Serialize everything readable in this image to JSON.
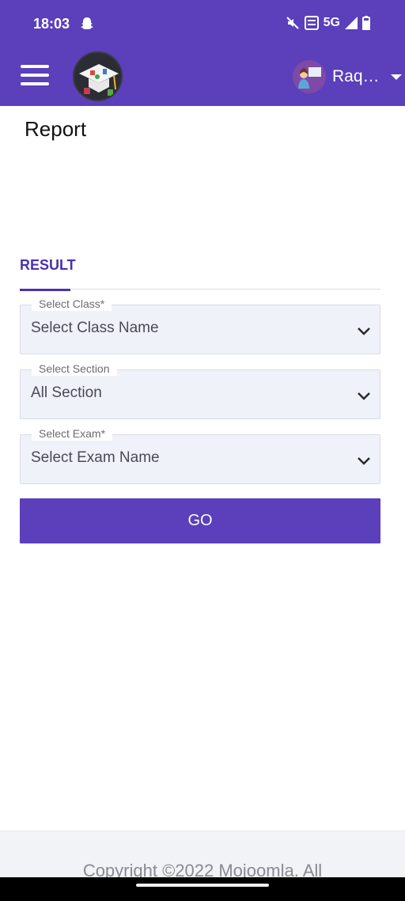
{
  "status_bar": {
    "time": "18:03",
    "network": "5G",
    "icons": [
      "snapchat-icon",
      "mute-icon",
      "volte-icon",
      "signal-icon",
      "battery-icon"
    ]
  },
  "app_bar": {
    "user_name": "Raq…",
    "icons": [
      "menu-icon",
      "logo",
      "avatar",
      "caret-down-icon"
    ]
  },
  "page": {
    "title": "Report"
  },
  "tabs": [
    {
      "label": "RESULT",
      "active": true
    }
  ],
  "form": {
    "class": {
      "label": "Select Class*",
      "value": "Select Class Name"
    },
    "section": {
      "label": "Select Section",
      "value": "All Section"
    },
    "exam": {
      "label": "Select Exam*",
      "value": "Select Exam Name"
    },
    "go_label": "GO"
  },
  "footer": {
    "text": "Copyright ©2022 Mojoomla. All"
  },
  "colors": {
    "primary": "#5b3fbb",
    "tab_active": "#4b30b0",
    "field_bg": "#eff2f8"
  }
}
